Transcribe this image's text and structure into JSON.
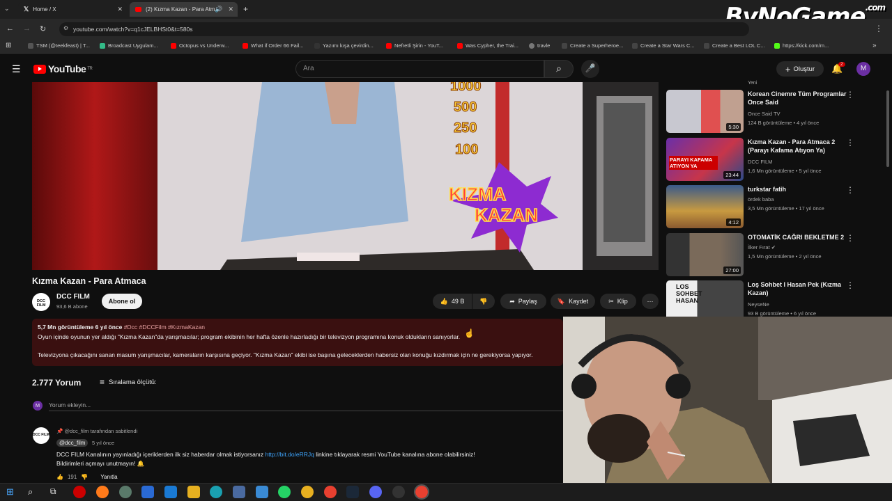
{
  "browser": {
    "tabs": [
      {
        "title": "Home / X",
        "active": false
      },
      {
        "title": "(2) Kızma Kazan - Para Atm",
        "active": true
      }
    ],
    "url": "youtube.com/watch?v=q1cJELBHSt0&t=580s",
    "bookmarks": [
      "TSM (@teekfeast) | T...",
      "Broadcast Uygulam...",
      "Octopus vs Underw...",
      "What if Order 66 Fail...",
      "Yazımı kışa çevirdin...",
      "Nefretli Şirin - YouT...",
      "Was Cypher, the Trai...",
      "travle",
      "Create a Superheroe...",
      "Create a Star Wars C...",
      "Create a Best LOL C...",
      "https://kick.com/m..."
    ]
  },
  "overlay_logo": {
    "text": "ByNoGame",
    "small": ".com"
  },
  "header": {
    "logo_text": "YouTube",
    "country": "TR",
    "search_placeholder": "Ara",
    "create_label": "Oluştur",
    "notif_count": "2",
    "avatar_letter": "M"
  },
  "video": {
    "overlay_numbers": [
      "1000",
      "500",
      "250",
      "100"
    ],
    "overlay_logo": [
      "KIZMA",
      "KAZAN"
    ],
    "title": "Kızma Kazan - Para Atmaca",
    "channel": "DCC FILM",
    "channel_logo": "DCC FILM",
    "subscribers": "93,6 B abone",
    "subscribe_label": "Abone ol",
    "likes": "49 B",
    "share_label": "Paylaş",
    "save_label": "Kaydet",
    "clip_label": "Klip",
    "more_label": "⋯"
  },
  "description": {
    "stats": "5,7 Mn görüntüleme  6 yıl önce",
    "tags": "#Dcc #DCCFilm #KızmaKazan",
    "line1": "Oyun içinde oyunun yer aldığı \"Kızma Kazan\"da yarışmacılar; program ekibinin her hafta özenle hazırladığı bir televizyon programına konuk oldukların sanıyorlar.",
    "line2": "Televizyona çıkacağını sanan masum yarışmacılar, kameraların karşısına geçiyor. \"Kızma Kazan\" ekibi ise başına geleceklerden habersiz olan konuğu kızdırmak için ne gerekiyorsa yapıyor."
  },
  "comments": {
    "count_label": "2.777 Yorum",
    "sort_label": "Sıralama ölçütü:",
    "add_placeholder": "Yorum ekleyin...",
    "user_avatar_letter": "M",
    "pinned_label": "@dcc_film tarafından sabitlendi",
    "pinned_author": "@dcc_film",
    "pinned_time": "5 yıl önce",
    "pinned_text_1": "DCC FILM Kanalının yayınladığı içeriklerden ilk siz haberdar olmak istiyorsanız ",
    "pinned_link": "http://bit.do/eRRJq",
    "pinned_text_2": " linkine tıklayarak resmi YouTube kanalına abone olabilirsiniz!",
    "pinned_text_3": "Bildirimleri açmayı unutmayın! 🔔",
    "pinned_likes": "191",
    "reply_label": "Yanıtla"
  },
  "sidebar": {
    "top_partial": "Yeni",
    "items": [
      {
        "title": "Korean Cinemre Tüm Programlar Once Said",
        "channel": "Once Said TV",
        "meta": "124 B görüntüleme • 4 yıl önce",
        "duration": "5:30"
      },
      {
        "title": "Kızma Kazan - Para Atmaca 2 (Parayı Kafama Atıyon Ya)",
        "channel": "DCC FILM",
        "meta": "1,6 Mn görüntüleme • 5 yıl önce",
        "duration": "23:44"
      },
      {
        "title": "turkstar fatih",
        "channel": "ördek baba",
        "meta": "3,5 Mn görüntüleme • 17 yıl önce",
        "duration": "4:12"
      },
      {
        "title": "OTOMATİK CAĞRI BEKLETME 2",
        "channel": "İlker Fırat ✔",
        "meta": "1,5 Mn görüntüleme • 2 yıl önce",
        "duration": "27:00"
      },
      {
        "title": "Loş Sohbet I Hasan Pek (Kızma Kazan)",
        "channel": "NeyseNe",
        "meta": "93 B görüntüleme • 6 yıl önce",
        "duration": ""
      }
    ],
    "thumb_text": [
      "PARAYI KAFAMA ATIYON YA",
      "LOS SOHBET HASAN"
    ]
  }
}
